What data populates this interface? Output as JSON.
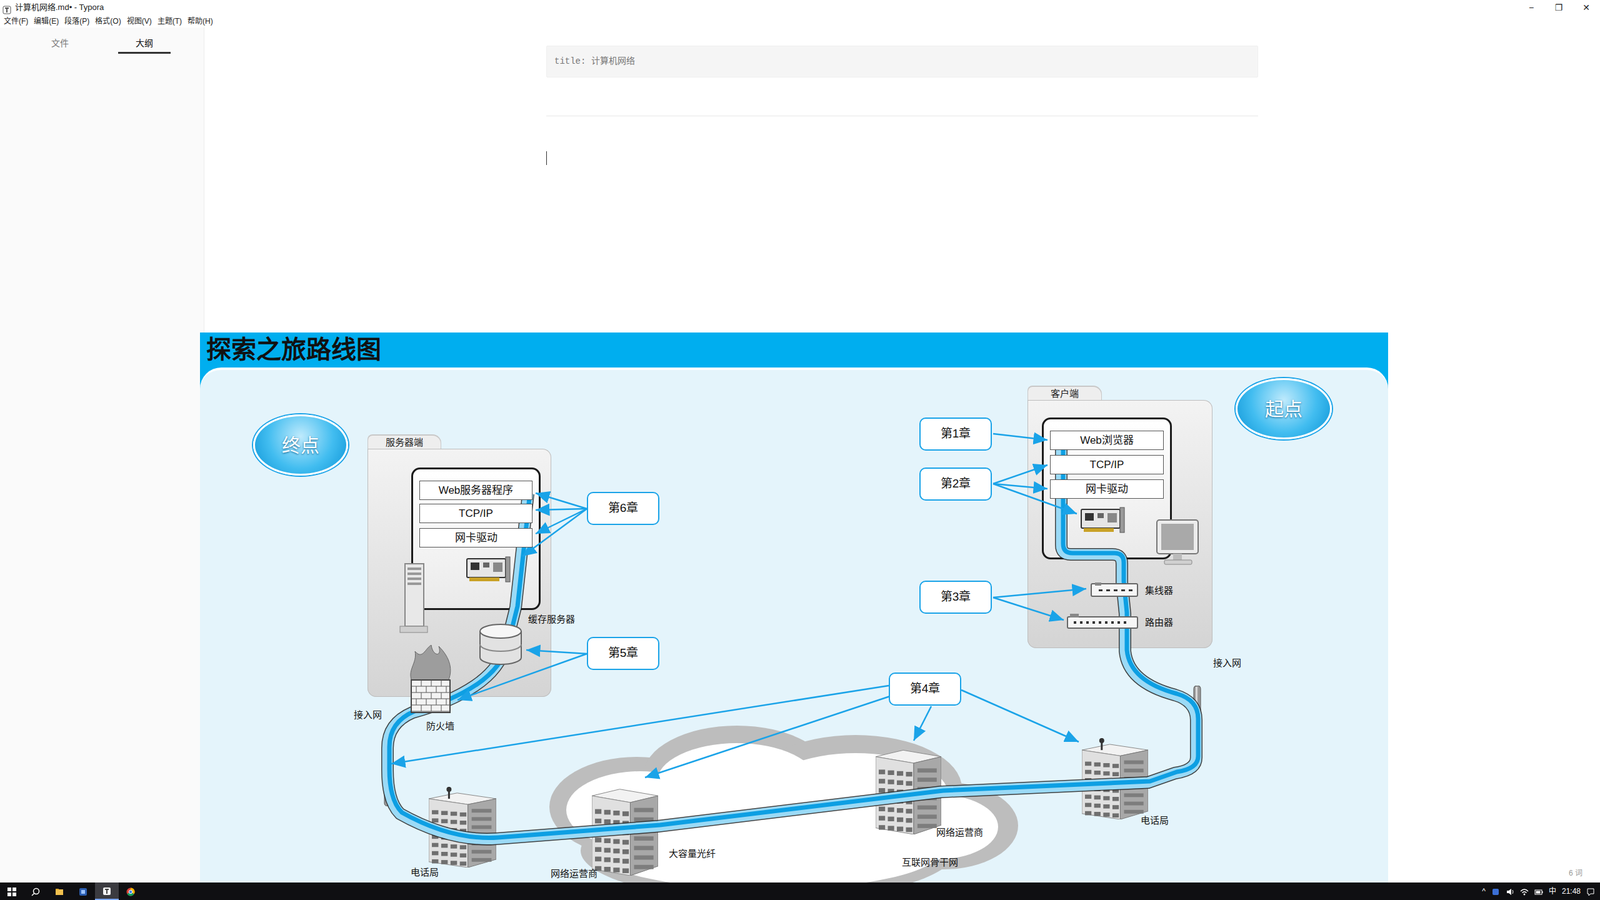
{
  "window": {
    "title": "计算机网络.md• - Typora",
    "controls": [
      "−",
      "❐",
      "✕"
    ]
  },
  "menu": [
    "文件(F)",
    "编辑(E)",
    "段落(P)",
    "格式(O)",
    "视图(V)",
    "主题(T)",
    "帮助(H)"
  ],
  "sidebar": {
    "tabs": [
      {
        "label": "文件",
        "selected": false
      },
      {
        "label": "大纲",
        "selected": true
      }
    ]
  },
  "editor": {
    "front_matter": "title: 计算机网络",
    "word_count": "6 词"
  },
  "figure": {
    "title": "探索之旅路线图",
    "start": "起点",
    "end": "终点",
    "client": {
      "label": "客户端",
      "layers": [
        "Web浏览器",
        "TCP/IP",
        "网卡驱动"
      ],
      "devices": [
        "集线器",
        "路由器"
      ]
    },
    "server": {
      "label": "服务器端",
      "layers": [
        "Web服务器程序",
        "TCP/IP",
        "网卡驱动"
      ],
      "devices": [
        "缓存服务器",
        "防火墙"
      ]
    },
    "network_labels": [
      "接入网",
      "电话局",
      "网络运营商",
      "大容量光纤",
      "网络运营商",
      "互联网骨干网",
      "电话局",
      "接入网"
    ],
    "chapters": [
      "第1章",
      "第2章",
      "第3章",
      "第4章",
      "第5章",
      "第6章"
    ]
  },
  "taskbar": {
    "tray_arrow": "^",
    "ime": "中",
    "time": "21:48"
  }
}
